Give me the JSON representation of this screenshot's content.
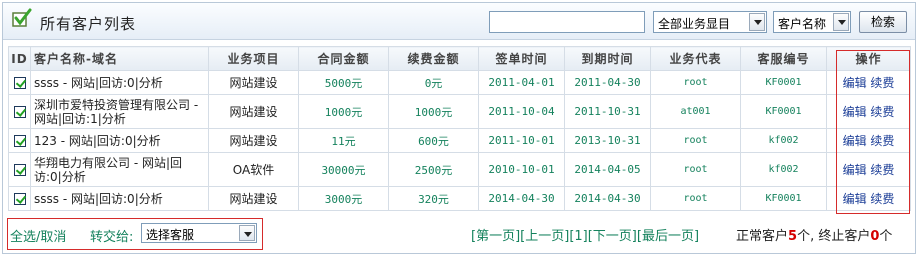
{
  "header": {
    "title": "所有客户列表",
    "search_value": "",
    "business_select": "全部业务显目",
    "field_select": "客户名称",
    "query_label": "检索"
  },
  "table": {
    "columns": [
      "ID",
      "客户名称-域名",
      "业务项目",
      "合同金额",
      "续费金额",
      "签单时间",
      "到期时间",
      "业务代表",
      "客服编号",
      "操作"
    ],
    "rows": [
      {
        "name": "ssss - 网站|回访:0|分析",
        "business": "网站建设",
        "contract": "5000元",
        "renew": "0元",
        "sign": "2011-04-01",
        "expire": "2011-04-30",
        "rep": "root",
        "cs": "KF0001",
        "edit": "编辑",
        "renew_op": "续费"
      },
      {
        "name": "深圳市爱特投资管理有限公司 - 网站|回访:1|分析",
        "business": "网站建设",
        "contract": "1000元",
        "renew": "1000元",
        "sign": "2011-10-04",
        "expire": "2011-10-31",
        "rep": "at001",
        "cs": "KF0001",
        "edit": "编辑",
        "renew_op": "续费"
      },
      {
        "name": "123 - 网站|回访:0|分析",
        "business": "网站建设",
        "contract": "11元",
        "renew": "600元",
        "sign": "2011-10-01",
        "expire": "2013-10-31",
        "rep": "root",
        "cs": "kf002",
        "edit": "编辑",
        "renew_op": "续费"
      },
      {
        "name": "华翔电力有限公司 - 网站|回访:0|分析",
        "business": "OA软件",
        "contract": "30000元",
        "renew": "2500元",
        "sign": "2010-10-01",
        "expire": "2014-04-05",
        "rep": "root",
        "cs": "kf002",
        "edit": "编辑",
        "renew_op": "续费"
      },
      {
        "name": "ssss - 网站|回访:0|分析",
        "business": "网站建设",
        "contract": "3000元",
        "renew": "320元",
        "sign": "2014-04-30",
        "expire": "2014-04-30",
        "rep": "root",
        "cs": "KF0001",
        "edit": "编辑",
        "renew_op": "续费"
      }
    ]
  },
  "footer": {
    "select_all": "全选/取消",
    "transfer_label": "转交给:",
    "cs_select": "选择客服",
    "pager": [
      "[第一页]",
      "[上一页]",
      "[1]",
      "[下一页]",
      "[最后一页]"
    ],
    "normal_label": "正常客户",
    "normal_count": "5",
    "unit1": "个, ",
    "stopped_label": "终止客户",
    "stopped_count": "0",
    "unit2": "个"
  },
  "colors": {
    "accent_green": "#15825d",
    "link_blue": "#1a3c96",
    "highlight_red": "#d52b2b"
  }
}
